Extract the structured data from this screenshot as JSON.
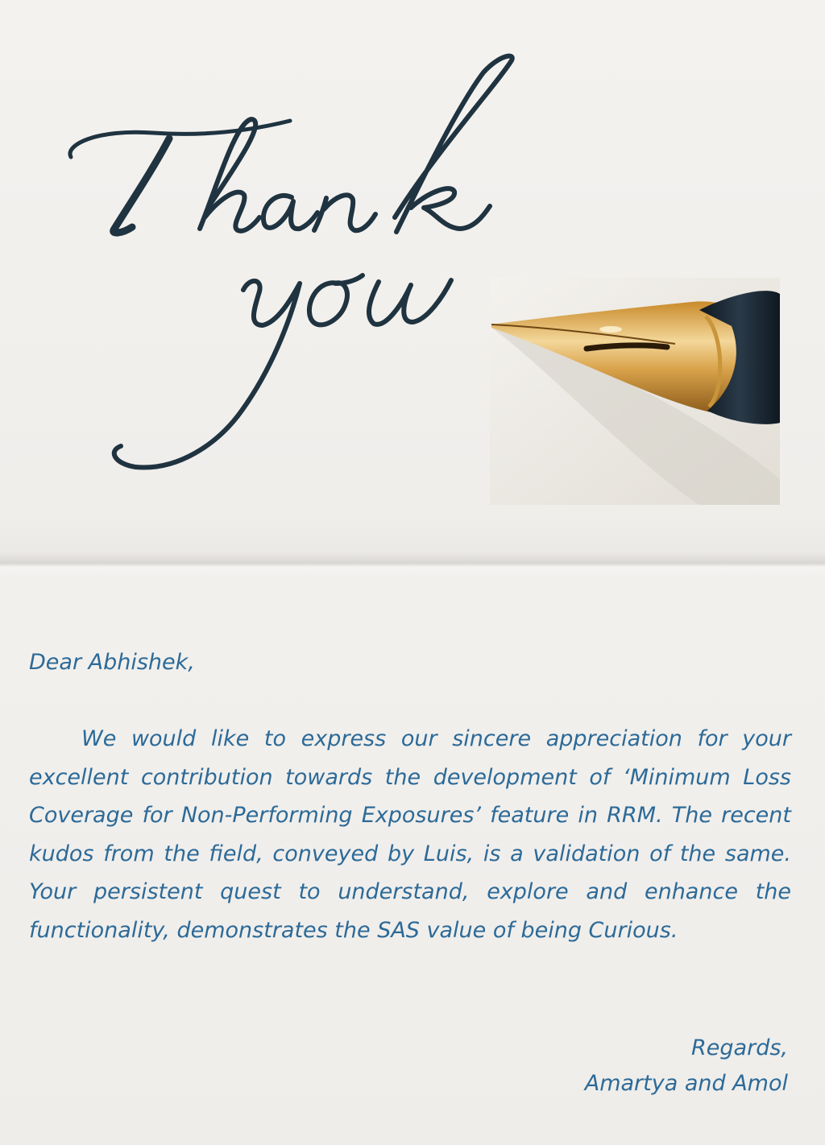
{
  "card": {
    "headline": [
      "Thank",
      "you"
    ],
    "colors": {
      "paper": "#f2f0ed",
      "headline_ink": "#1f3340",
      "body_ink": "#2c6a98",
      "pen_gold": "#d9a24a",
      "pen_barrel": "#1a2530"
    },
    "illustration": "fountain-pen-nib"
  },
  "letter": {
    "salutation": "Dear Abhishek,",
    "body": "We would like to express our sincere appreciation for your excellent contribution towards the development of ‘Minimum Loss Coverage for Non-Performing Exposures’ feature in RRM. The recent kudos from the field, conveyed by Luis, is a validation of the same. Your persistent quest to understand, explore and enhance the functionality, demonstrates the SAS value of being Curious.",
    "closing": "Regards,",
    "signature": "Amartya and Amol"
  }
}
